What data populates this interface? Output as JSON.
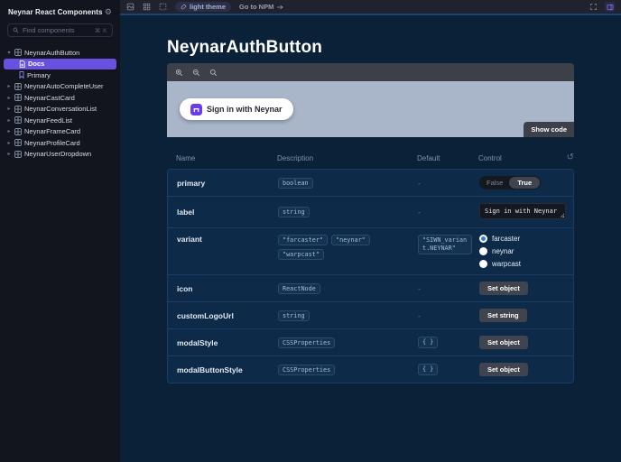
{
  "sidebar": {
    "title": "Neynar React Components",
    "search": {
      "placeholder": "Find components",
      "shortcut": "⌘ K"
    },
    "tree": [
      {
        "label": "NeynarAuthButton",
        "expanded": true,
        "children": [
          {
            "label": "Docs",
            "type": "docs",
            "selected": true
          },
          {
            "label": "Primary",
            "type": "story",
            "selected": false
          }
        ]
      },
      {
        "label": "NeynarAutoCompleteUser",
        "expanded": false
      },
      {
        "label": "NeynarCastCard",
        "expanded": false
      },
      {
        "label": "NeynarConversationList",
        "expanded": false
      },
      {
        "label": "NeynarFeedList",
        "expanded": false
      },
      {
        "label": "NeynarFrameCard",
        "expanded": false
      },
      {
        "label": "NeynarProfileCard",
        "expanded": false
      },
      {
        "label": "NeynarUserDropdown",
        "expanded": false
      }
    ]
  },
  "topbar": {
    "theme_label": "light theme",
    "npm_label": "Go to NPM"
  },
  "main": {
    "title": "NeynarAuthButton",
    "preview": {
      "signin_label": "Sign in with Neynar",
      "show_code_label": "Show code"
    },
    "args_table": {
      "columns": [
        "Name",
        "Description",
        "Default",
        "Control"
      ],
      "rows": [
        {
          "name": "primary",
          "type_badges": [
            "boolean"
          ],
          "default": "-",
          "control": {
            "kind": "boolean",
            "false_label": "False",
            "true_label": "True",
            "value": true
          }
        },
        {
          "name": "label",
          "type_badges": [
            "string"
          ],
          "default": "-",
          "control": {
            "kind": "text",
            "value": "Sign in with Neynar"
          }
        },
        {
          "name": "variant",
          "type_badges": [
            "\"farcaster\"",
            "\"neynar\"",
            "\"warpcast\""
          ],
          "default_badge": "\"SIWN_variant.NEYNAR\"",
          "control": {
            "kind": "radio",
            "options": [
              "farcaster",
              "neynar",
              "warpcast"
            ],
            "selected": "farcaster"
          }
        },
        {
          "name": "icon",
          "type_badges": [
            "ReactNode"
          ],
          "default": "-",
          "control": {
            "kind": "button",
            "label": "Set object"
          }
        },
        {
          "name": "customLogoUrl",
          "type_badges": [
            "string"
          ],
          "default": "-",
          "control": {
            "kind": "button",
            "label": "Set string"
          }
        },
        {
          "name": "modalStyle",
          "type_badges": [
            "CSSProperties"
          ],
          "default_badge": "{ }",
          "control": {
            "kind": "button",
            "label": "Set object"
          }
        },
        {
          "name": "modalButtonStyle",
          "type_badges": [
            "CSSProperties"
          ],
          "default_badge": "{ }",
          "control": {
            "kind": "button",
            "label": "Set object"
          }
        }
      ]
    }
  },
  "icons": {
    "gear": "⚙",
    "reset": "↺",
    "arrow_right": "→",
    "chevron_down": "▾",
    "chevron_right": "▸"
  },
  "colors": {
    "accent_purple": "#6951e0",
    "farcaster_purple": "#6a3de8",
    "preview_bg": "#a9b6c9",
    "radio_selected_blue": "#2f7fd6",
    "canvas_bg": "#0a2138",
    "sidebar_bg": "#13151e"
  }
}
